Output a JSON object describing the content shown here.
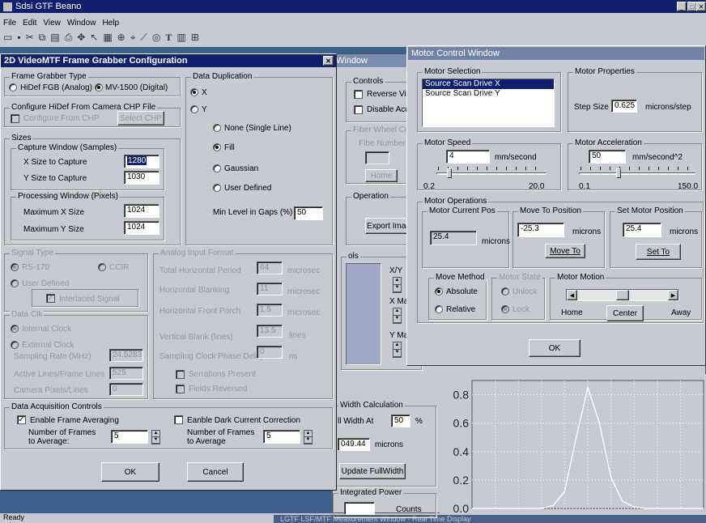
{
  "app": {
    "title": "Sdsi  GTF Beano",
    "menu": [
      "File",
      "Edit",
      "View",
      "Window",
      "Help"
    ],
    "status": "Ready",
    "bottom_title": "LGTF   LSF/MTF Measurement Window - Real Time Display"
  },
  "config": {
    "title": "2D VideoMTF Frame Grabber Configuration",
    "close": "✕",
    "grabber_type": {
      "label": "Frame Grabber Type",
      "opt1": "HiDef FGB (Analog)",
      "opt2": "MV-1500 (Digital)"
    },
    "configure": {
      "label": "Configure HiDef From Camera CHP File",
      "checkbox": "Configure From CHP",
      "button": "Select CHP"
    },
    "sizes": {
      "label": "Sizes",
      "capture_label": "Capture Window (Samples)",
      "x_label": "X Size to Capture",
      "x_value": "1280",
      "y_label": "Y Size to Capture",
      "y_value": "1030",
      "proc_label": "Processing Window  (Pixels)",
      "mx_label": "Maximum X Size",
      "mx_value": "1024",
      "my_label": "Maximum Y Size",
      "my_value": "1024"
    },
    "dup": {
      "label": "Data Duplication",
      "x": "X",
      "y": "Y",
      "none": "None (Single Line)",
      "fill": "Fill",
      "gauss": "Gaussian",
      "user": "User Defined",
      "min_label": "Min Level in Gaps (%)",
      "min_value": "50"
    },
    "signal": {
      "label": "Signal Type",
      "rs": "RS-170",
      "ccir": "CCIR",
      "user": "User Defined",
      "interlaced": "Interlaced Signal"
    },
    "clock": {
      "label": "Data Clk",
      "internal": "Internal Clock",
      "external": "External Clock",
      "rate_label": "Sampling Rate (MHz)",
      "rate_value": "24.5283",
      "lines_label": "Active Lines/Frame Lines",
      "lines_value": "525",
      "camera_label": "Camera Pixels/Lines",
      "camera_value": "0"
    },
    "analog": {
      "label": "Analog Input Format",
      "total_label": "Total Horizontal Period",
      "total_value": "64",
      "hsync_label": "Horizontal Blanking",
      "hsync_value": "11",
      "front_label": "Horizontal Front Porch",
      "front_value": "1.5",
      "unit": "microsec",
      "vblank_label": "Vertical Blank (lines)",
      "vblank_value": "13.5",
      "vunit": "lines",
      "delay_label": "Sampling Clock Phase Delay",
      "delay_value": "0",
      "dunit": "ns",
      "serrate": "Serrations Present",
      "field": "Fields Reversed"
    },
    "acq": {
      "label": "Data Acquisition Controls",
      "avg_chk": "Enable Frame Averaging",
      "num_label": "Number of Frames to Average:",
      "num_value": "5",
      "dark_chk": "Eanble Dark Current Correction",
      "dark_label": "Number of Frames to Average",
      "dark_value": "5"
    },
    "ok": "OK",
    "cancel": "Cancel"
  },
  "motor": {
    "title": "Motor Control Window",
    "sel_label": "Motor Selection",
    "items": [
      "Source Scan Drive X",
      "Source Scan Drive Y"
    ],
    "props_label": "Motor Properties",
    "step_label": "Step Size",
    "step_value": "0.625",
    "step_unit": "microns/step",
    "speed_label": "Motor Speed",
    "speed_value": "4",
    "speed_unit": "mm/second",
    "speed_min": "0.2",
    "speed_max": "20.0",
    "speed_level": 0.1,
    "accel_label": "Motor Acceleration",
    "accel_value": "50",
    "accel_unit": "mm/second^2",
    "accel_min": "0.1",
    "accel_max": "150.0",
    "accel_level": 0.33,
    "ops_label": "Motor Operations",
    "pos_label": "Motor Current Pos",
    "pos_value": "25.4",
    "pos_unit": "microns",
    "move_label": "Move To Position",
    "move_value": "-25.3",
    "move_unit": "microns",
    "move_btn": "Move To",
    "set_label": "Set Motor Position",
    "set_value": "25.4",
    "set_unit": "microns",
    "set_btn": "Set To",
    "method_label": "Move Method",
    "absolute": "Absolute",
    "relative": "Relative",
    "state_label": "Motor State",
    "unlock": "Unlock",
    "lock": "Lock",
    "motion_label": "Motor Motion",
    "home": "Home",
    "center": "Center",
    "away": "Away",
    "ok": "OK"
  },
  "back": {
    "win_title": "Window",
    "controls_label": "Controls",
    "reverse": "Reverse Vid",
    "disable": "Disable Acq",
    "frame_label": "Fiber Wheel Cont",
    "frame_num": "Fibe Number",
    "home": "Home",
    "operation_label": "Operation",
    "export": "Export Imag",
    "tools_label": "ols",
    "xy": "X/Y",
    "xm": "X Ma",
    "ym": "Y Ma",
    "width_label": "Width Calculation",
    "fullwidth": "ll Width At",
    "fw_value": "50",
    "pct": "%",
    "width_value": "049.44",
    "microns": "microns",
    "update": "Update FullWidth",
    "power_label": "Integrated Power",
    "counts": "Counts"
  },
  "chart_data": {
    "type": "line",
    "x": [
      0,
      0.05,
      0.1,
      0.15,
      0.2,
      0.25,
      0.3,
      0.35,
      0.4,
      0.45,
      0.5,
      0.55,
      0.6,
      0.65,
      0.7,
      0.75,
      0.8,
      0.85,
      0.9,
      0.95,
      1.0
    ],
    "y": [
      0,
      0,
      0,
      0,
      0,
      0,
      0,
      0.02,
      0.12,
      0.5,
      0.85,
      0.6,
      0.22,
      0.05,
      0.01,
      0,
      0,
      0,
      0,
      0,
      0
    ],
    "y_ticks": [
      "0.8",
      "0.6",
      "0.4",
      "0.2",
      "0.0"
    ],
    "ylim": [
      0,
      0.9
    ],
    "grid": true
  }
}
